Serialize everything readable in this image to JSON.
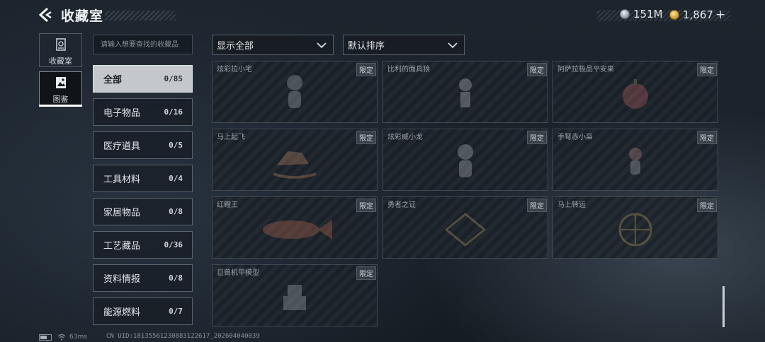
{
  "header": {
    "title": "收藏室",
    "silver_amount": "151M",
    "gold_amount": "1,867",
    "add_label": "+"
  },
  "nav": {
    "collection_label": "收藏室",
    "album_label": "图鉴"
  },
  "search": {
    "placeholder": "请输入想要查找的收藏品"
  },
  "filter": {
    "selected": "显示全部"
  },
  "sort": {
    "selected": "默认排序"
  },
  "categories": [
    {
      "name": "全部",
      "count": "0/85"
    },
    {
      "name": "电子物品",
      "count": "0/16"
    },
    {
      "name": "医疗道具",
      "count": "0/5"
    },
    {
      "name": "工具材料",
      "count": "0/4"
    },
    {
      "name": "家居物品",
      "count": "0/8"
    },
    {
      "name": "工艺藏品",
      "count": "0/36"
    },
    {
      "name": "资料情报",
      "count": "0/8"
    },
    {
      "name": "能源燃料",
      "count": "0/7"
    }
  ],
  "items": [
    {
      "name": "炫彩拉小宅",
      "tag": "限定"
    },
    {
      "name": "比利的面具狼",
      "tag": "限定"
    },
    {
      "name": "阿萨拉极品平安果",
      "tag": "限定"
    },
    {
      "name": "马上起飞",
      "tag": "限定"
    },
    {
      "name": "炫彩威小龙",
      "tag": "限定"
    },
    {
      "name": "手弩赤小枭",
      "tag": "限定"
    },
    {
      "name": "红鲤王",
      "tag": "限定"
    },
    {
      "name": "勇者之证",
      "tag": "限定"
    },
    {
      "name": "马上转运",
      "tag": "限定"
    },
    {
      "name": "巨兽机甲模型",
      "tag": "限定"
    }
  ],
  "status": {
    "ping": "63ms",
    "uid": "CN UID:18135561230883122617_202604040039"
  }
}
